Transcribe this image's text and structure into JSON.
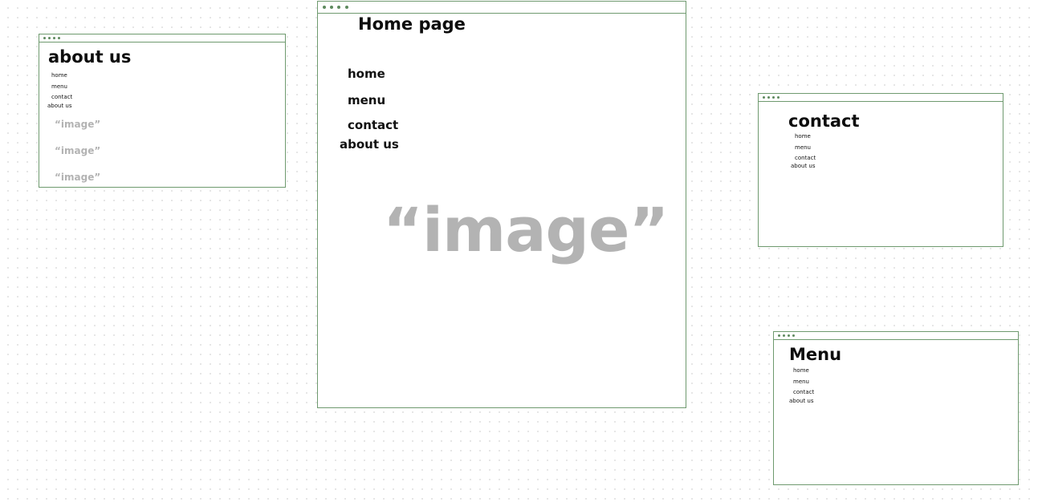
{
  "accent_color": "#6f9a6f",
  "frames": {
    "about_us": {
      "title": "about us",
      "nav": [
        "home",
        "menu",
        "contact",
        "about us"
      ],
      "images": [
        "“image”",
        "“image”",
        "“image”"
      ]
    },
    "home_page": {
      "title": "Home page",
      "nav": [
        "home",
        "menu",
        "contact",
        "about us"
      ],
      "image": "“image”"
    },
    "contact": {
      "title": "contact",
      "nav": [
        "home",
        "menu",
        "contact",
        "about us"
      ]
    },
    "menu": {
      "title": "Menu",
      "nav": [
        "home",
        "menu",
        "contact",
        "about us"
      ]
    }
  }
}
